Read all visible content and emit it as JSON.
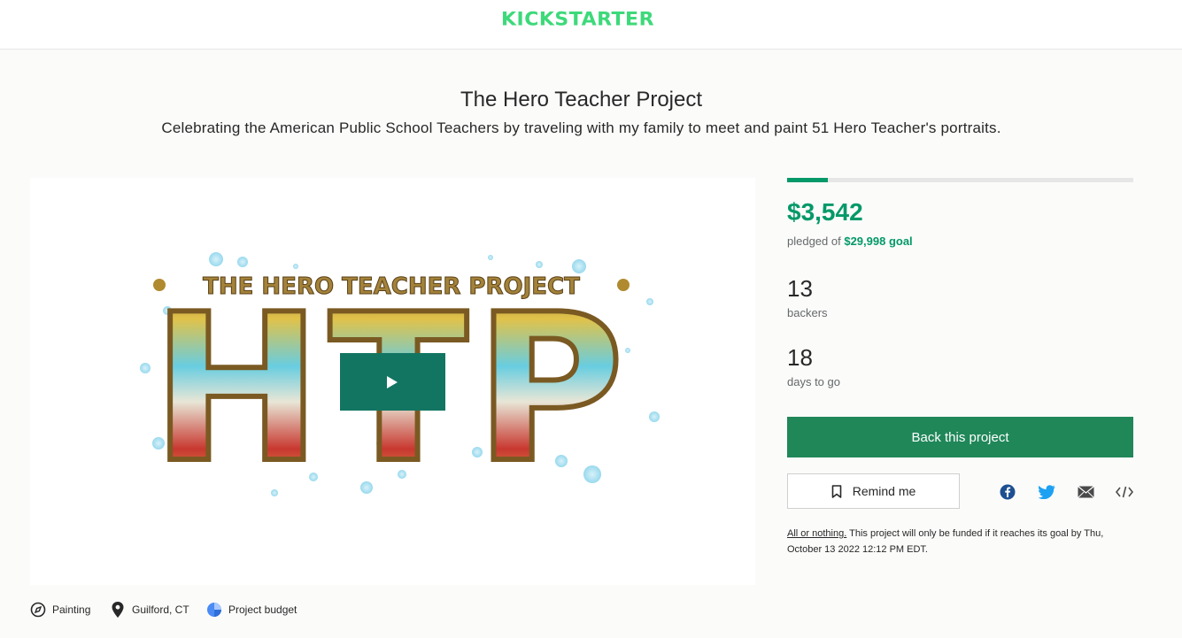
{
  "header": {
    "logo": "KICKSTARTER"
  },
  "project": {
    "title": "The Hero Teacher Project",
    "blurb": "Celebrating the American Public School Teachers by traveling with my family to meet and paint 51 Hero Teacher's portraits."
  },
  "video": {
    "poster_text": "THE HERO TEACHER PROJECT",
    "poster_letters": "HTP"
  },
  "tags": {
    "category": "Painting",
    "location": "Guilford, CT",
    "budget": "Project budget"
  },
  "stats": {
    "progress_fraction": 0.118,
    "pledged": "$3,542",
    "pledged_of": "pledged of ",
    "goal": "$29,998 goal",
    "backers": "13",
    "backers_label": "backers",
    "days": "18",
    "days_label": "days to go"
  },
  "actions": {
    "back_label": "Back this project",
    "remind_label": "Remind me"
  },
  "share_icons": [
    "facebook-icon",
    "twitter-icon",
    "email-icon",
    "embed-icon"
  ],
  "funding_note": {
    "aon": "All or nothing.",
    "text": " This project will only be funded if it reaches its goal by Thu, October 13 2022 12:12 PM EDT."
  },
  "colors": {
    "accent": "#039968",
    "button": "#208759",
    "logo": "#3dd97a",
    "play": "#127562"
  }
}
